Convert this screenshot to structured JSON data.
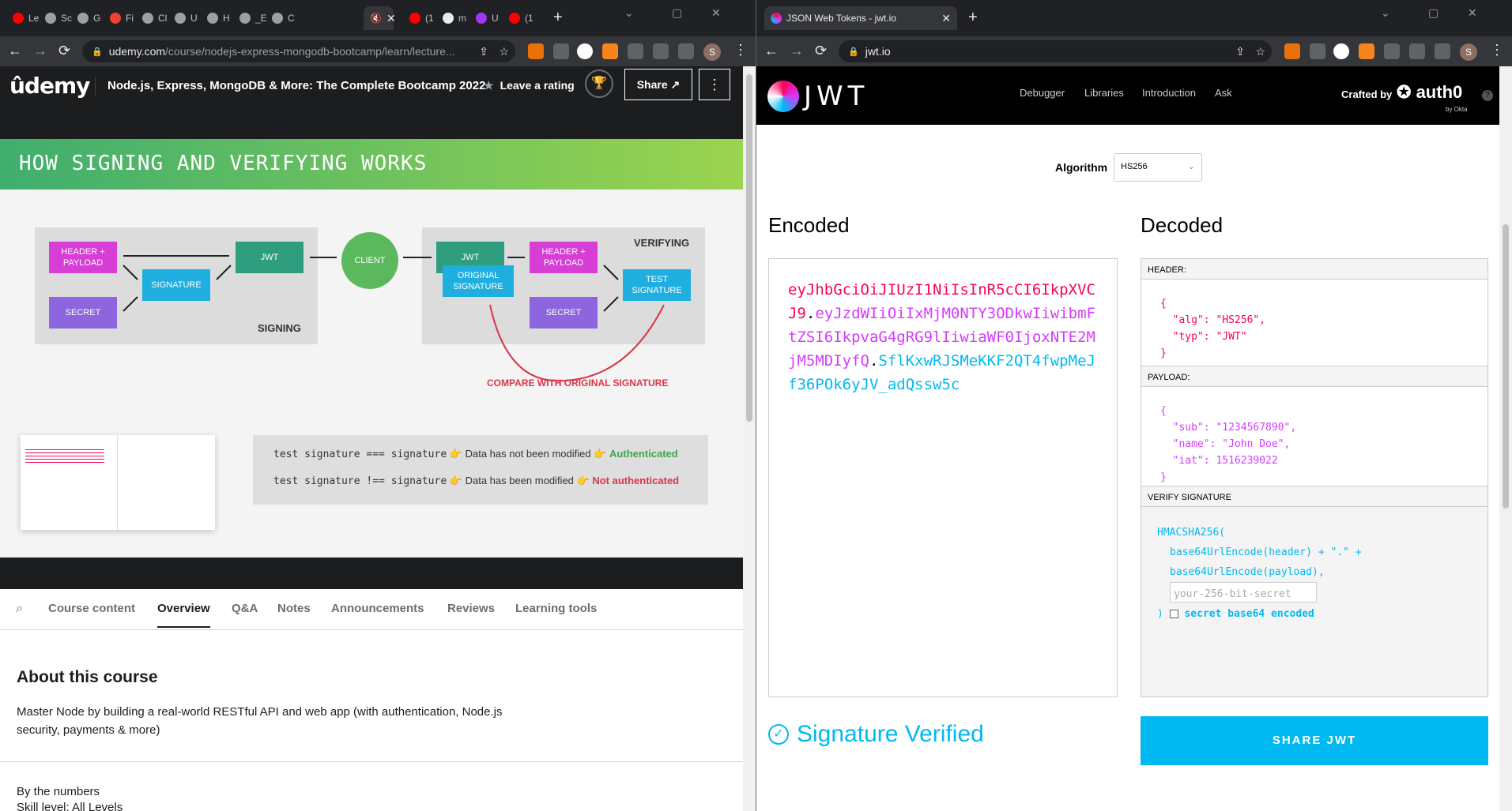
{
  "left": {
    "tabs": [
      {
        "label": "Le",
        "color": "#ff0000"
      },
      {
        "label": "Sc",
        "color": "#9aa0a6"
      },
      {
        "label": "G",
        "color": "#9aa0a6"
      },
      {
        "label": "Fi",
        "color": "#ea4335"
      },
      {
        "label": "Cl",
        "color": "#9aa0a6"
      },
      {
        "label": "U",
        "color": "#9aa0a6"
      },
      {
        "label": "H",
        "color": "#9aa0a6"
      },
      {
        "label": "_E",
        "color": "#9aa0a6"
      },
      {
        "label": "C",
        "color": "#9aa0a6"
      },
      {
        "label": "(1",
        "color": "#ff0000"
      },
      {
        "label": "m",
        "color": "#e8eaed"
      },
      {
        "label": "U",
        "color": "#a435f0"
      },
      {
        "label": "(1",
        "color": "#ff0000"
      }
    ],
    "url_host": "udemy.com",
    "url_path": "/course/nodejs-express-mongodb-bootcamp/learn/lecture...",
    "header": {
      "logo": "ûdemy",
      "title": "Node.js, Express, MongoDB & More: The Complete Bootcamp 2022",
      "rating": "Leave a rating",
      "share": "Share"
    },
    "slide": {
      "title": "HOW SIGNING AND VERIFYING WORKS",
      "boxes": {
        "header_payload": "HEADER + PAYLOAD",
        "signature": "SIGNATURE",
        "secret": "SECRET",
        "jwt": "JWT",
        "client": "CLIENT",
        "jwt2": "JWT",
        "original_signature": "ORIGINAL SIGNATURE",
        "header_payload2": "HEADER + PAYLOAD",
        "secret2": "SECRET",
        "test_signature": "TEST SIGNATURE"
      },
      "signing_label": "SIGNING",
      "verifying_label": "VERIFYING",
      "compare": "COMPARE WITH ORIGINAL SIGNATURE",
      "line1": {
        "code": "test signature === signature",
        "text": "Data has not been modified",
        "result": "Authenticated"
      },
      "line2": {
        "code": "test signature !== signature",
        "text": "Data has been modified",
        "result": "Not authenticated"
      }
    },
    "course_tabs": [
      "Course content",
      "Overview",
      "Q&A",
      "Notes",
      "Announcements",
      "Reviews",
      "Learning tools"
    ],
    "about": {
      "title": "About this course",
      "desc": "Master Node by building a real-world RESTful API and web app (with authentication, Node.js security, payments & more)",
      "numbers": "By the numbers",
      "skill": "Skill level: All Levels"
    }
  },
  "right": {
    "tab_title": "JSON Web Tokens - jwt.io",
    "url_host": "jwt.io",
    "logo": "JWT",
    "nav": [
      "Debugger",
      "Libraries",
      "Introduction",
      "Ask"
    ],
    "crafted": "Crafted by",
    "auth0": "auth0",
    "by_okta": "by Okta",
    "algorithm_label": "Algorithm",
    "algorithm": "HS256",
    "encoded_title": "Encoded",
    "decoded_title": "Decoded",
    "token_header": "eyJhbGciOiJIUzI1NiIsInR5cCI6IkpXVCJ9",
    "token_payload": "eyJzdWIiOiIxMjM0NTY3ODkwIiwibmFtZSI6IkpvaG4gRG9lIiwiaWF0IjoxNTE2MjM5MDIyfQ",
    "token_sig": "SflKxwRJSMeKKF2QT4fwpMeJf36POk6yJV_adQssw5c",
    "header_label": "HEADER:",
    "payload_label": "PAYLOAD:",
    "verify_label": "VERIFY SIGNATURE",
    "header_json": {
      "alg": "HS256",
      "typ": "JWT"
    },
    "payload_json": {
      "sub": "1234567890",
      "name": "John Doe",
      "iat": 1516239022
    },
    "verify": {
      "fn": "HMACSHA256(",
      "l2": "base64UrlEncode(header) + \".\" +",
      "l3": "base64UrlEncode(payload),",
      "secret_placeholder": "your-256-bit-secret",
      "close": ")",
      "checkbox": "secret base64 encoded"
    },
    "verified": "Signature Verified",
    "share": "SHARE JWT"
  },
  "colors": {
    "jwt_header": "#fb015b",
    "jwt_payload": "#d63aff",
    "jwt_sig": "#00b9f1",
    "udemy_bg": "#1c1d1f"
  }
}
